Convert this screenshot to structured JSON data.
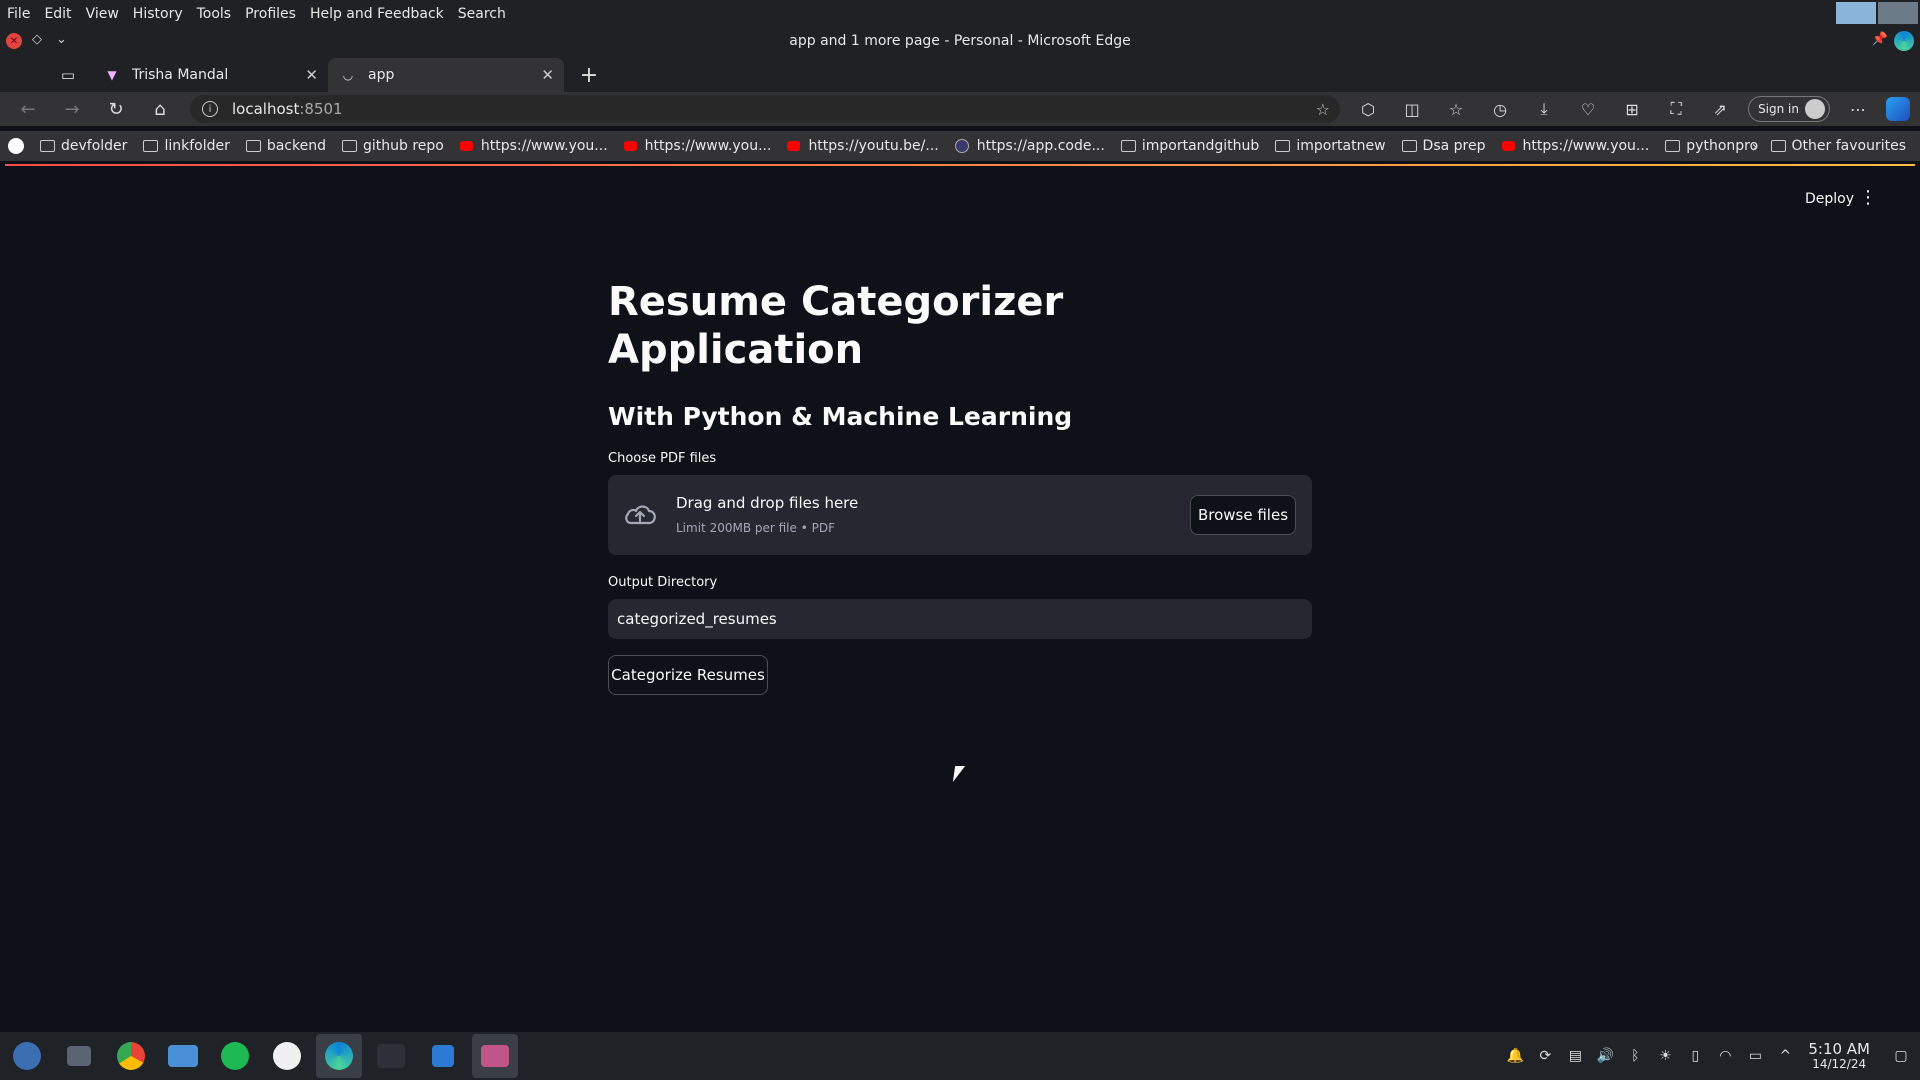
{
  "menubar": {
    "items": [
      "File",
      "Edit",
      "View",
      "History",
      "Tools",
      "Profiles",
      "Help and Feedback",
      "Search"
    ]
  },
  "window": {
    "title": "app and 1 more page - Personal - Microsoft Edge"
  },
  "tabs": [
    {
      "label": "Trisha Mandal",
      "active": false
    },
    {
      "label": "app",
      "active": true
    }
  ],
  "address": {
    "host": "localhost",
    "port": ":8501"
  },
  "toolbar": {
    "signin_label": "Sign in"
  },
  "bookmarks": {
    "items": [
      "devfolder",
      "linkfolder",
      "backend",
      "github repo",
      "https://www.you...",
      "https://www.you...",
      "https://youtu.be/...",
      "https://app.code...",
      "importandgithub",
      "importatnew",
      "Dsa prep",
      "https://www.you...",
      "pythonpro"
    ],
    "other": "Other favourites"
  },
  "streamlit": {
    "deploy_label": "Deploy",
    "title": "Resume Categorizer Application",
    "subtitle": "With Python & Machine Learning",
    "uploader": {
      "label": "Choose PDF files",
      "drop_text": "Drag and drop files here",
      "limit_text": "Limit 200MB per file • PDF",
      "browse_label": "Browse files"
    },
    "output": {
      "label": "Output Directory",
      "value": "categorized_resumes"
    },
    "categorize_label": "Categorize Resumes"
  },
  "taskbar": {
    "time": "5:10 AM",
    "date": "14/12/24"
  },
  "colors": {
    "page_bg": "#0e1117",
    "widget_bg": "#262730",
    "accent": "#ff4b4b"
  }
}
